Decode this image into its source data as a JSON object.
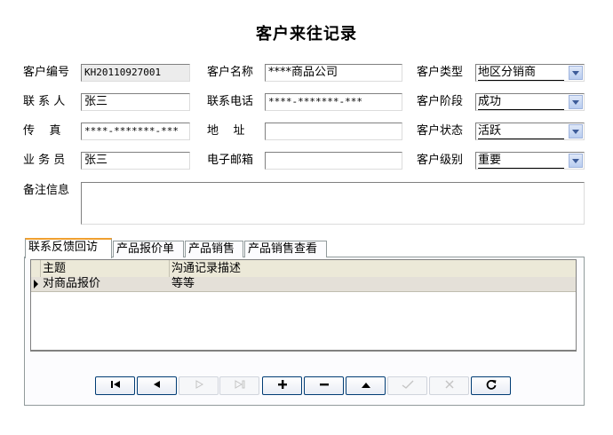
{
  "form_title": "客户来往记录",
  "fields": {
    "customer_no": {
      "label": "客户编号",
      "value": "KH20110927001"
    },
    "customer_name": {
      "label": "客户名称",
      "value": "****商品公司"
    },
    "customer_type": {
      "label": "客户类型",
      "value": "地区分销商"
    },
    "contact": {
      "label": "联 系 人",
      "value": "张三"
    },
    "phone": {
      "label": "联系电话",
      "value": "****-*******-***"
    },
    "stage": {
      "label": "客户阶段",
      "value": "成功"
    },
    "fax": {
      "label": "传    真",
      "value": "****-*******-***"
    },
    "address": {
      "label": "地    址",
      "value": ""
    },
    "status": {
      "label": "客户状态",
      "value": "活跃"
    },
    "salesman": {
      "label": "业 务 员",
      "value": "张三"
    },
    "email": {
      "label": "电子邮箱",
      "value": ""
    },
    "level": {
      "label": "客户级别",
      "value": "重要"
    },
    "remarks": {
      "label": "备注信息",
      "value": ""
    }
  },
  "tabs": [
    {
      "label": "联系反馈回访",
      "active": true
    },
    {
      "label": "产品报价单",
      "active": false
    },
    {
      "label": "产品销售",
      "active": false
    },
    {
      "label": "产品销售查看",
      "active": false
    }
  ],
  "grid": {
    "columns": [
      "主题",
      "沟通记录描述"
    ],
    "rows": [
      {
        "subject": "对商品报价",
        "description": "等等"
      }
    ]
  },
  "navigator": {
    "first_icon": "first-record-icon",
    "prior_icon": "prior-record-icon",
    "next_icon": "next-record-icon",
    "last_icon": "last-record-icon",
    "insert_icon": "insert-record-icon",
    "delete_icon": "delete-record-icon",
    "edit_icon": "edit-record-icon",
    "post_icon": "post-record-icon",
    "cancel_icon": "cancel-record-icon",
    "refresh_icon": "refresh-record-icon"
  },
  "colors": {
    "active_tab_accent": "#f0a030",
    "combo_button": "#b9cdf0",
    "grid_header": "#ece9d8",
    "readonly_field": "#ececec"
  }
}
